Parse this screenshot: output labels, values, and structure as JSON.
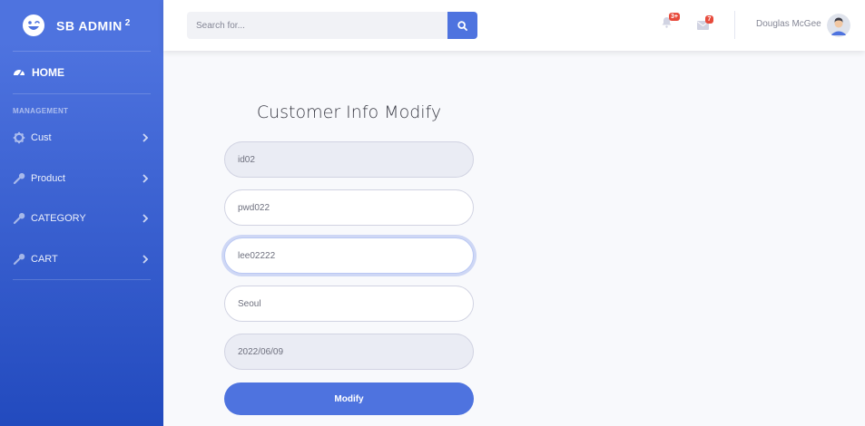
{
  "brand": {
    "name": "SB ADMIN",
    "sup": "2"
  },
  "sidebar": {
    "home": "HOME",
    "heading": "MANAGEMENT",
    "items": [
      {
        "label": "Cust",
        "icon": "gear-icon"
      },
      {
        "label": "Product",
        "icon": "wrench-icon"
      },
      {
        "label": "CATEGORY",
        "icon": "wrench-icon"
      },
      {
        "label": "CART",
        "icon": "wrench-icon"
      }
    ]
  },
  "topbar": {
    "search_placeholder": "Search for...",
    "alerts_badge": "3+",
    "messages_badge": "7",
    "user_name": "Douglas McGee"
  },
  "form": {
    "title": "Customer Info Modify",
    "id_value": "id02",
    "pwd_value": "pwd022",
    "name_value": "lee02222",
    "address_value": "Seoul",
    "date_value": "2022/06/09",
    "submit_label": "Modify"
  },
  "colors": {
    "primary": "#4e73df",
    "sidebar_gradient_end": "#224abe",
    "badge": "#e74a3b"
  }
}
